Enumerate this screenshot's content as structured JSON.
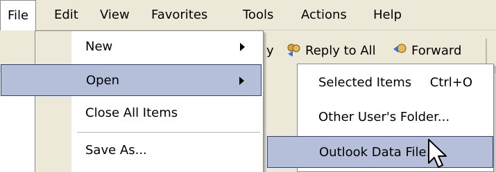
{
  "menubar": {
    "items": [
      {
        "label": "File"
      },
      {
        "label": "Edit"
      },
      {
        "label": "View"
      },
      {
        "label": "Favorites"
      },
      {
        "label": "Tools"
      },
      {
        "label": "Actions"
      },
      {
        "label": "Help"
      }
    ]
  },
  "toolbar": {
    "reply_all": "Reply to All",
    "forward": "Forward"
  },
  "file_menu": {
    "new": "New",
    "open": "Open",
    "close_all": "Close All Items",
    "save_as": "Save As..."
  },
  "open_submenu": {
    "selected_items": "Selected Items",
    "selected_items_shortcut": "Ctrl+O",
    "other_users_folder": "Other User's Folder...",
    "outlook_data_file": "Outlook Data File..."
  },
  "icons": {
    "reply_all": "reply-all-icon",
    "forward": "forward-icon",
    "cursor": "mouse-pointer-icon"
  },
  "colors": {
    "highlight": "#b6bfd9",
    "highlight_border": "#2f3c86",
    "menu_bg": "#ffffff",
    "chrome": "#ece9d8"
  }
}
